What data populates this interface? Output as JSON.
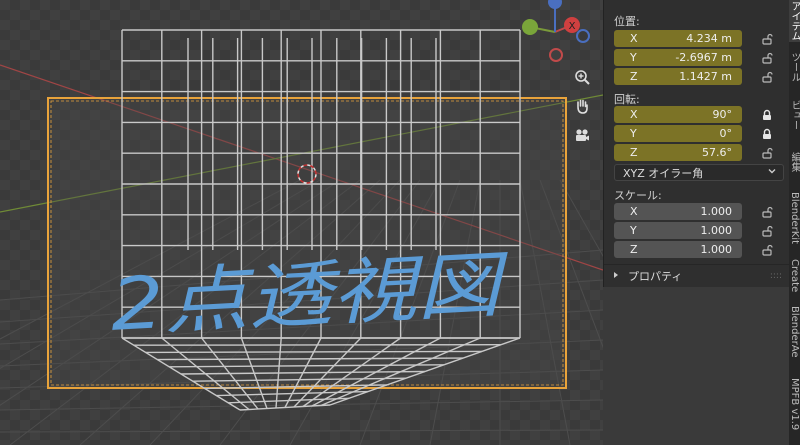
{
  "viewport": {
    "handwriting": "2点透視図",
    "navigation": {
      "axis_x_label": "X",
      "zoom_icon": "zoom-icon",
      "pan_icon": "hand-icon",
      "camera_icon": "camera-icon"
    },
    "colors": {
      "x_axis": "#c04a4a",
      "y_axis": "#7a9a3a",
      "selection": "#e8a33b",
      "handwriting": "#5b9bd5"
    }
  },
  "npanel": {
    "location": {
      "title": "位置:",
      "rows": [
        {
          "axis": "X",
          "value": "4.234 m"
        },
        {
          "axis": "Y",
          "value": "-2.6967 m"
        },
        {
          "axis": "Z",
          "value": "1.1427 m"
        }
      ]
    },
    "rotation": {
      "title": "回転:",
      "rows": [
        {
          "axis": "X",
          "value": "90°"
        },
        {
          "axis": "Y",
          "value": "0°"
        },
        {
          "axis": "Z",
          "value": "57.6°"
        }
      ],
      "mode": "XYZ オイラー角"
    },
    "scale": {
      "title": "スケール:",
      "rows": [
        {
          "axis": "X",
          "value": "1.000"
        },
        {
          "axis": "Y",
          "value": "1.000"
        },
        {
          "axis": "Z",
          "value": "1.000"
        }
      ]
    },
    "properties_label": "プロパティ"
  },
  "tabs": [
    "アイテム",
    "ツール",
    "ビュー",
    "編集",
    "BlenderKit",
    "Create",
    "BlenderAe",
    "MPFB v1.9"
  ]
}
